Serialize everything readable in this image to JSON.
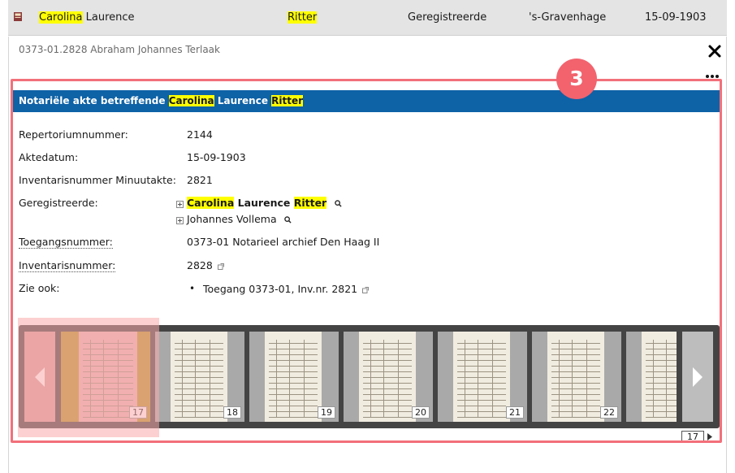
{
  "result_row": {
    "first_name": "Carolina",
    "middle_name": "Laurence",
    "surname": "Ritter",
    "role": "Geregistreerde",
    "place": "'s-Gravenhage",
    "date": "15-09-1903"
  },
  "panel": {
    "title": "0373-01.2828 Abraham Johannes Terlaak",
    "badge": "3",
    "header": {
      "prefix": "Notariële akte betreffende",
      "first": "Carolina",
      "middle": "Laurence",
      "last": "Ritter"
    },
    "fields": {
      "repertorium_label": "Repertoriumnummer:",
      "repertorium_value": "2144",
      "aktedatum_label": "Aktedatum:",
      "aktedatum_value": "15-09-1903",
      "inventaris_minuut_label": "Inventarisnummer Minuutakte:",
      "inventaris_minuut_value": "2821",
      "geregistreerde_label": "Geregistreerde:",
      "toegang_label": "Toegangsnummer:",
      "toegang_value": "0373-01 Notarieel archief Den Haag II",
      "inventaris_label": "Inventarisnummer:",
      "inventaris_value": "2828",
      "zie_ook_label": "Zie ook:",
      "zie_ook_item": "Toegang 0373-01, Inv.nr. 2821"
    },
    "persons": [
      {
        "first": "Carolina",
        "middle": "Laurence",
        "last": "Ritter"
      },
      {
        "name": "Johannes Vollema"
      }
    ]
  },
  "carousel": {
    "thumbnails": [
      "17",
      "18",
      "19",
      "20",
      "21",
      "22"
    ],
    "selected": "17"
  },
  "pager": {
    "current": "17"
  },
  "colors": {
    "highlight": "#ffff00",
    "header_blue": "#0e62a6",
    "annotation_red": "#f2636e"
  }
}
